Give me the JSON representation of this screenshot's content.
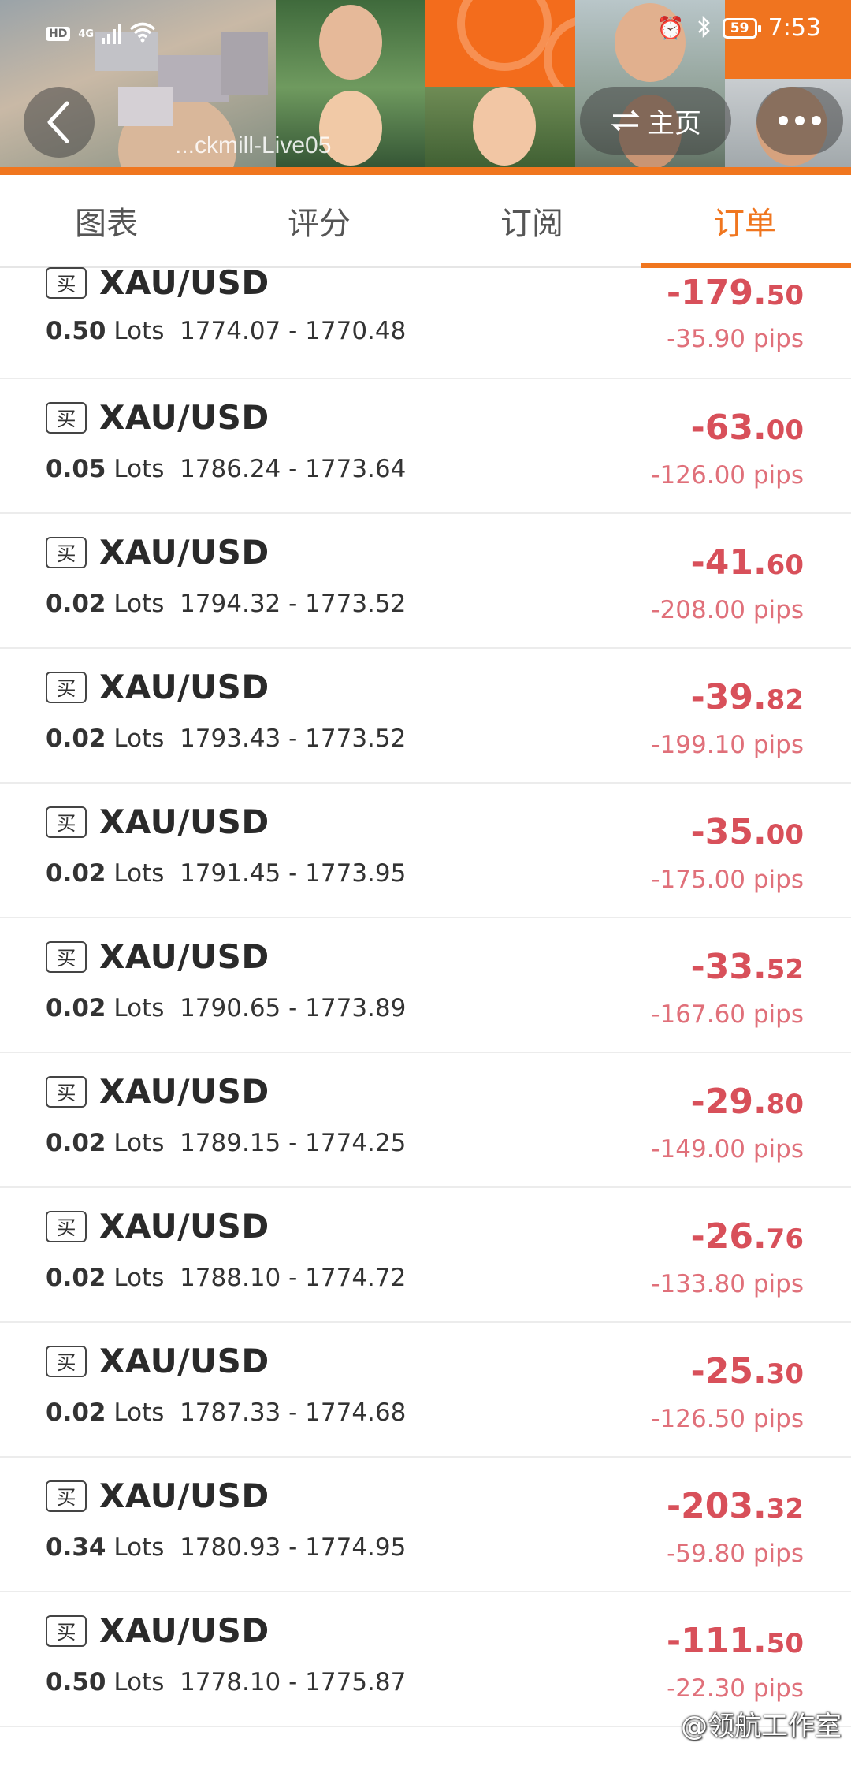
{
  "status_bar": {
    "hd": "HD",
    "network": "4G",
    "battery": "59",
    "time": "7:53"
  },
  "header": {
    "account": "...ckmill-Live05",
    "home_label": "主页"
  },
  "tabs": [
    {
      "label": "图表"
    },
    {
      "label": "评分"
    },
    {
      "label": "订阅"
    },
    {
      "label": "订单",
      "active": true
    }
  ],
  "orders": [
    {
      "side": "买",
      "symbol": "XAU/USD",
      "lots": "0.50",
      "lots_unit": "Lots",
      "prices": "1774.07 - 1770.48",
      "pnl_int": "-179.",
      "pnl_dec": "50",
      "pips": "-35.90 pips"
    },
    {
      "side": "买",
      "symbol": "XAU/USD",
      "lots": "0.05",
      "lots_unit": "Lots",
      "prices": "1786.24 - 1773.64",
      "pnl_int": "-63.",
      "pnl_dec": "00",
      "pips": "-126.00 pips"
    },
    {
      "side": "买",
      "symbol": "XAU/USD",
      "lots": "0.02",
      "lots_unit": "Lots",
      "prices": "1794.32 - 1773.52",
      "pnl_int": "-41.",
      "pnl_dec": "60",
      "pips": "-208.00 pips"
    },
    {
      "side": "买",
      "symbol": "XAU/USD",
      "lots": "0.02",
      "lots_unit": "Lots",
      "prices": "1793.43 - 1773.52",
      "pnl_int": "-39.",
      "pnl_dec": "82",
      "pips": "-199.10 pips"
    },
    {
      "side": "买",
      "symbol": "XAU/USD",
      "lots": "0.02",
      "lots_unit": "Lots",
      "prices": "1791.45 - 1773.95",
      "pnl_int": "-35.",
      "pnl_dec": "00",
      "pips": "-175.00 pips"
    },
    {
      "side": "买",
      "symbol": "XAU/USD",
      "lots": "0.02",
      "lots_unit": "Lots",
      "prices": "1790.65 - 1773.89",
      "pnl_int": "-33.",
      "pnl_dec": "52",
      "pips": "-167.60 pips"
    },
    {
      "side": "买",
      "symbol": "XAU/USD",
      "lots": "0.02",
      "lots_unit": "Lots",
      "prices": "1789.15 - 1774.25",
      "pnl_int": "-29.",
      "pnl_dec": "80",
      "pips": "-149.00 pips"
    },
    {
      "side": "买",
      "symbol": "XAU/USD",
      "lots": "0.02",
      "lots_unit": "Lots",
      "prices": "1788.10 - 1774.72",
      "pnl_int": "-26.",
      "pnl_dec": "76",
      "pips": "-133.80 pips"
    },
    {
      "side": "买",
      "symbol": "XAU/USD",
      "lots": "0.02",
      "lots_unit": "Lots",
      "prices": "1787.33 - 1774.68",
      "pnl_int": "-25.",
      "pnl_dec": "30",
      "pips": "-126.50 pips"
    },
    {
      "side": "买",
      "symbol": "XAU/USD",
      "lots": "0.34",
      "lots_unit": "Lots",
      "prices": "1780.93 - 1774.95",
      "pnl_int": "-203.",
      "pnl_dec": "32",
      "pips": "-59.80 pips"
    },
    {
      "side": "买",
      "symbol": "XAU/USD",
      "lots": "0.50",
      "lots_unit": "Lots",
      "prices": "1778.10 - 1775.87",
      "pnl_int": "-111.",
      "pnl_dec": "50",
      "pips": "-22.30 pips"
    }
  ],
  "watermark": "@领航工作室",
  "colors": {
    "accent": "#f0761f",
    "loss": "#d8505a"
  }
}
